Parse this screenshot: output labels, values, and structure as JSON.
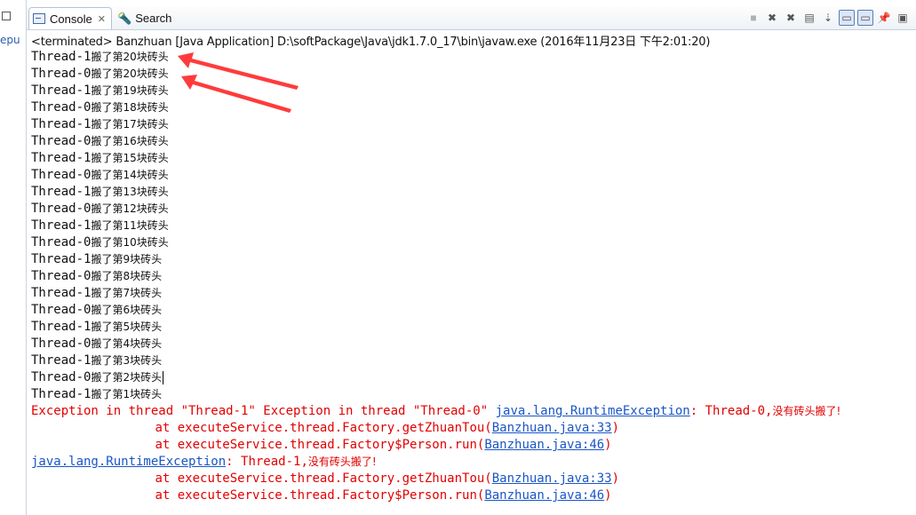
{
  "left_panel": {
    "partial_text": "epu"
  },
  "tabs": [
    {
      "label": "Console",
      "active": true,
      "icon": "console-icon"
    },
    {
      "label": "Search",
      "active": false,
      "icon": "search-icon"
    }
  ],
  "toolbar": {
    "icons": [
      "terminate-icon",
      "remove-launch-icon",
      "remove-all-icon",
      "clear-console-icon",
      "scroll-lock-icon",
      "show-on-stdout-icon",
      "show-on-stderr-icon",
      "pin-console-icon",
      "open-console-icon"
    ]
  },
  "status": "<terminated> Banzhuan [Java Application] D:\\softPackage\\Java\\jdk1.7.0_17\\bin\\javaw.exe (2016年11月23日 下午2:01:20)",
  "output": [
    {
      "thread": "Thread-1",
      "msg": "搬了第20块砖头"
    },
    {
      "thread": "Thread-0",
      "msg": "搬了第20块砖头"
    },
    {
      "thread": "Thread-1",
      "msg": "搬了第19块砖头"
    },
    {
      "thread": "Thread-0",
      "msg": "搬了第18块砖头"
    },
    {
      "thread": "Thread-1",
      "msg": "搬了第17块砖头"
    },
    {
      "thread": "Thread-0",
      "msg": "搬了第16块砖头"
    },
    {
      "thread": "Thread-1",
      "msg": "搬了第15块砖头"
    },
    {
      "thread": "Thread-0",
      "msg": "搬了第14块砖头"
    },
    {
      "thread": "Thread-1",
      "msg": "搬了第13块砖头"
    },
    {
      "thread": "Thread-0",
      "msg": "搬了第12块砖头"
    },
    {
      "thread": "Thread-1",
      "msg": "搬了第11块砖头"
    },
    {
      "thread": "Thread-0",
      "msg": "搬了第10块砖头"
    },
    {
      "thread": "Thread-1",
      "msg": "搬了第9块砖头"
    },
    {
      "thread": "Thread-0",
      "msg": "搬了第8块砖头"
    },
    {
      "thread": "Thread-1",
      "msg": "搬了第7块砖头"
    },
    {
      "thread": "Thread-0",
      "msg": "搬了第6块砖头"
    },
    {
      "thread": "Thread-1",
      "msg": "搬了第5块砖头"
    },
    {
      "thread": "Thread-0",
      "msg": "搬了第4块砖头"
    },
    {
      "thread": "Thread-1",
      "msg": "搬了第3块砖头"
    },
    {
      "thread": "Thread-0",
      "msg": "搬了第2块砖头"
    },
    {
      "thread": "Thread-1",
      "msg": "搬了第1块砖头"
    }
  ],
  "errors": {
    "line1_prefix": "Exception in thread \"Thread-1\" Exception in thread \"Thread-0\" ",
    "line1_link": "java.lang.RuntimeException",
    "line1_suffix_mono": ": Thread-0,",
    "line1_suffix_cjk": "没有砖头搬了!",
    "line2_prefix": "\tat executeService.thread.Factory.getZhuanTou(",
    "line2_link": "Banzhuan.java:33",
    "line2_suffix": ")",
    "line3_prefix": "\tat executeService.thread.Factory$Person.run(",
    "line3_link": "Banzhuan.java:46",
    "line3_suffix": ")",
    "line4_link": "java.lang.RuntimeException",
    "line4_suffix_mono": ": Thread-1,",
    "line4_suffix_cjk": "没有砖头搬了!",
    "line5_prefix": "\tat executeService.thread.Factory.getZhuanTou(",
    "line5_link": "Banzhuan.java:33",
    "line5_suffix": ")",
    "line6_prefix": "\tat executeService.thread.Factory$Person.run(",
    "line6_link": "Banzhuan.java:46",
    "line6_suffix": ")"
  },
  "colors": {
    "error": "#e30000",
    "link": "#1a56c6",
    "arrow": "#ff3b3b"
  }
}
